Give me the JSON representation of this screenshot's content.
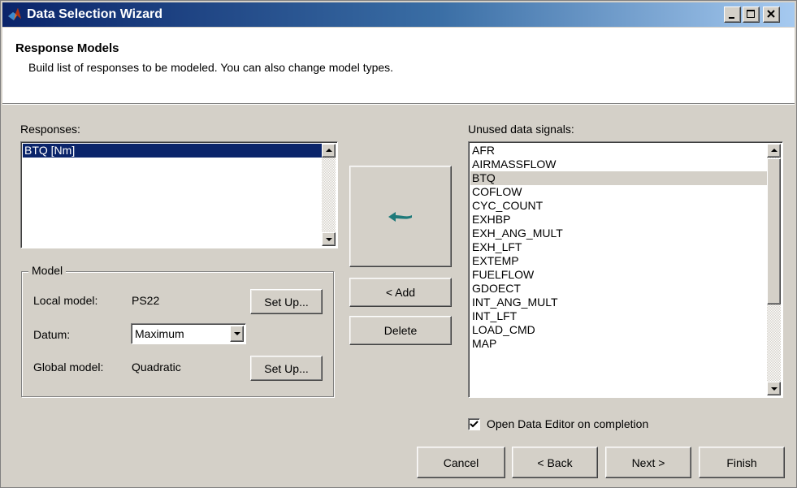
{
  "window": {
    "title": "Data Selection Wizard",
    "min_glyph": "_",
    "max_glyph": "□",
    "close_glyph": "✕"
  },
  "header": {
    "title": "Response Models",
    "description": "Build list of responses to be modeled. You can also change model types."
  },
  "responses": {
    "label": "Responses:",
    "items": [
      "BTQ [Nm]"
    ],
    "selected_index": 0
  },
  "model": {
    "legend": "Model",
    "local_model_label": "Local model:",
    "local_model_value": "PS22",
    "local_setup_label": "Set Up...",
    "datum_label": "Datum:",
    "datum_value": "Maximum",
    "global_model_label": "Global model:",
    "global_model_value": "Quadratic",
    "global_setup_label": "Set Up..."
  },
  "actions": {
    "arrow_icon": "left-arrow-icon",
    "add_label": "< Add",
    "delete_label": "Delete"
  },
  "unused": {
    "label": "Unused data signals:",
    "items": [
      "AFR",
      "AIRMASSFLOW",
      "BTQ",
      "COFLOW",
      "CYC_COUNT",
      "EXHBP",
      "EXH_ANG_MULT",
      "EXH_LFT",
      "EXTEMP",
      "FUELFLOW",
      "GDOECT",
      "INT_ANG_MULT",
      "INT_LFT",
      "LOAD_CMD",
      "MAP"
    ],
    "selected_index": 2
  },
  "options": {
    "open_editor_label": "Open Data Editor on completion",
    "open_editor_checked": true
  },
  "footer": {
    "cancel_label": "Cancel",
    "back_label": "< Back",
    "next_label": "Next >",
    "finish_label": "Finish"
  },
  "colors": {
    "titlebar_start": "#0a246a",
    "selection_dark": "#0a246a",
    "arrow": "#1f7a7a",
    "face": "#d4d0c8"
  }
}
